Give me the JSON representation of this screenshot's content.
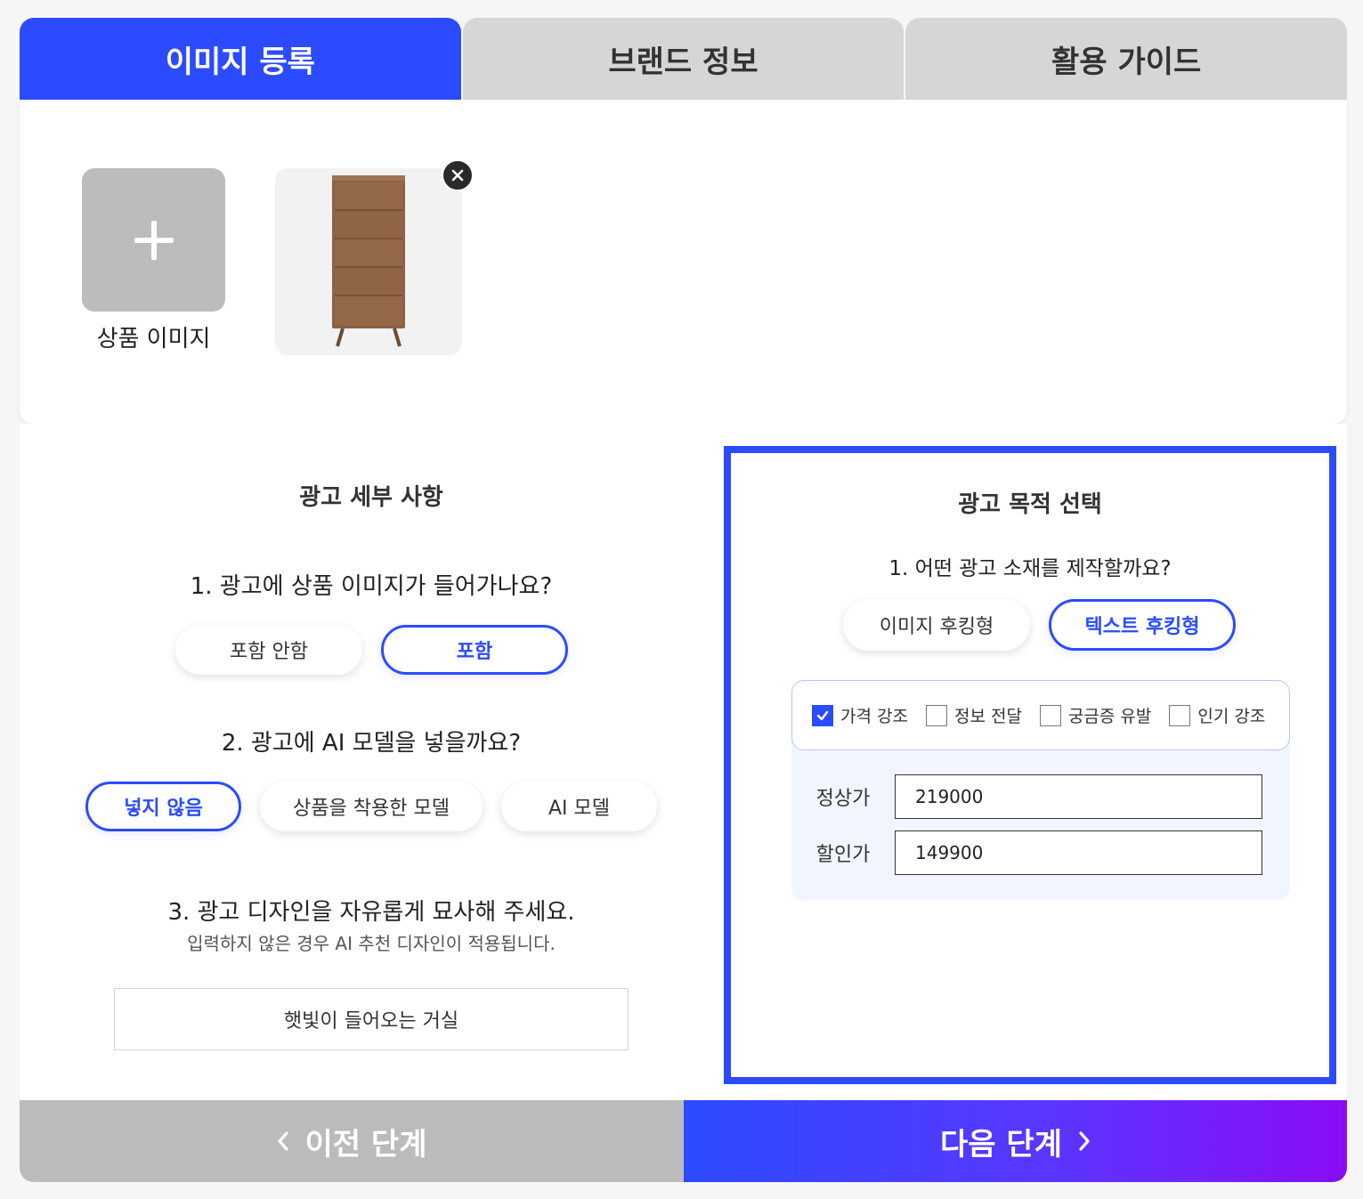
{
  "tabs": [
    {
      "label": "이미지 등록",
      "active": true
    },
    {
      "label": "브랜드 정보",
      "active": false
    },
    {
      "label": "활용 가이드",
      "active": false
    }
  ],
  "image_upload": {
    "add_label": "상품 이미지",
    "add_icon": "plus-icon",
    "remove_icon": "close-icon"
  },
  "ad_details": {
    "title": "광고 세부 사항",
    "q1": {
      "text": "1. 광고에 상품 이미지가 들어가나요?",
      "options": [
        "포함 안함",
        "포함"
      ],
      "selected": "포함"
    },
    "q2": {
      "text": "2. 광고에 AI 모델을 넣을까요?",
      "options": [
        "넣지 않음",
        "상품을 착용한 모델",
        "AI 모델"
      ],
      "selected": "넣지 않음"
    },
    "q3": {
      "text": "3. 광고 디자인을 자유롭게 묘사해 주세요.",
      "hint": "입력하지 않은 경우 AI 추천 디자인이 적용됩니다.",
      "value": "햇빛이 들어오는 거실"
    }
  },
  "ad_purpose": {
    "title": "광고 목적 선택",
    "q1": {
      "text": "1. 어떤 광고 소재를 제작할까요?",
      "options": [
        "이미지 후킹형",
        "텍스트 후킹형"
      ],
      "selected": "텍스트 후킹형"
    },
    "checks": [
      {
        "label": "가격 강조",
        "checked": true
      },
      {
        "label": "정보 전달",
        "checked": false
      },
      {
        "label": "궁금증 유발",
        "checked": false
      },
      {
        "label": "인기 강조",
        "checked": false
      }
    ],
    "regular_price": {
      "label": "정상가",
      "value": "219000"
    },
    "sale_price": {
      "label": "할인가",
      "value": "149900"
    }
  },
  "footer": {
    "prev_label": "이전 단계",
    "next_label": "다음 단계"
  },
  "colors": {
    "accent": "#2c4bff",
    "gradient_end": "#8a0cf5",
    "tab_inactive": "#d6d6d6",
    "prev_button": "#bbbbbb"
  }
}
